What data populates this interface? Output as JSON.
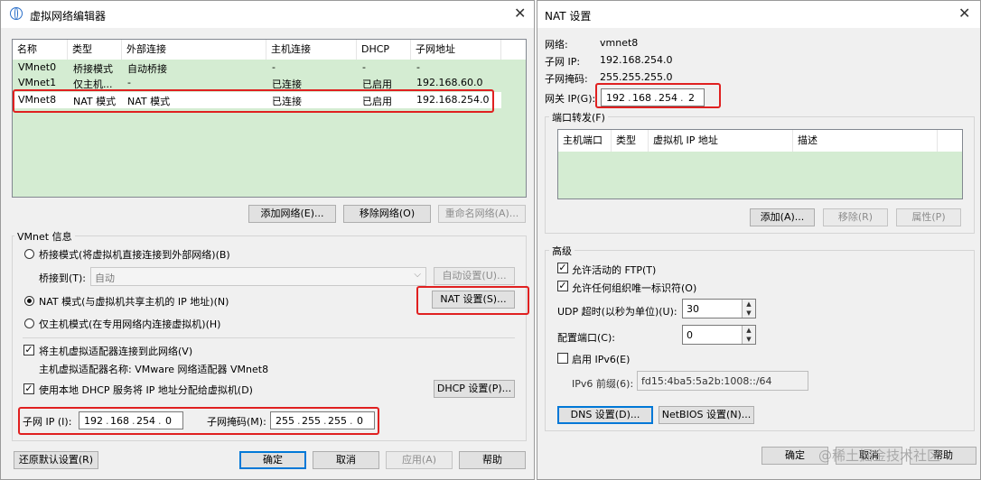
{
  "vne": {
    "title": "虚拟网络编辑器",
    "columns": [
      "名称",
      "类型",
      "外部连接",
      "主机连接",
      "DHCP",
      "子网地址"
    ],
    "rows": [
      [
        "VMnet0",
        "桥接模式",
        "自动桥接",
        "-",
        "-",
        "-"
      ],
      [
        "VMnet1",
        "仅主机...",
        "-",
        "已连接",
        "已启用",
        "192.168.60.0"
      ],
      [
        "VMnet8",
        "NAT 模式",
        "NAT 模式",
        "已连接",
        "已启用",
        "192.168.254.0"
      ]
    ],
    "add_network": "添加网络(E)...",
    "remove_network": "移除网络(O)",
    "rename_network": "重命名网络(A)...",
    "vmnet_info": "VMnet 信息",
    "bridge_mode": "桥接模式(将虚拟机直接连接到外部网络)(B)",
    "bridge_to_label": "桥接到(T):",
    "bridge_to_value": "自动",
    "auto_settings": "自动设置(U)...",
    "nat_mode": "NAT 模式(与虚拟机共享主机的 IP 地址)(N)",
    "nat_settings": "NAT 设置(S)...",
    "host_only": "仅主机模式(在专用网络内连接虚拟机)(H)",
    "connect_adapter": "将主机虚拟适配器连接到此网络(V)",
    "adapter_name": "主机虚拟适配器名称: VMware 网络适配器 VMnet8",
    "use_dhcp": "使用本地 DHCP 服务将 IP 地址分配给虚拟机(D)",
    "dhcp_settings": "DHCP 设置(P)...",
    "subnet_ip_label": "子网 IP (I):",
    "subnet_ip": [
      "192",
      "168",
      "254",
      "0"
    ],
    "subnet_mask_label": "子网掩码(M):",
    "subnet_mask": [
      "255",
      "255",
      "255",
      "0"
    ],
    "restore_defaults": "还原默认设置(R)",
    "ok": "确定",
    "cancel": "取消",
    "apply": "应用(A)",
    "help": "帮助"
  },
  "nat": {
    "title": "NAT 设置",
    "network_label": "网络:",
    "network_value": "vmnet8",
    "subnet_ip_label": "子网 IP:",
    "subnet_ip_value": "192.168.254.0",
    "subnet_mask_label": "子网掩码:",
    "subnet_mask_value": "255.255.255.0",
    "gateway_label": "网关 IP(G):",
    "gateway": [
      "192",
      "168",
      "254",
      "2"
    ],
    "port_forwarding": "端口转发(F)",
    "pf_columns": [
      "主机端口",
      "类型",
      "虚拟机 IP 地址",
      "描述"
    ],
    "add": "添加(A)...",
    "remove": "移除(R)",
    "properties": "属性(P)",
    "advanced": "高级",
    "allow_ftp": "允许活动的 FTP(T)",
    "allow_oui": "允许任何组织唯一标识符(O)",
    "udp_label": "UDP 超时(以秒为单位)(U):",
    "udp_value": "30",
    "config_port_label": "配置端口(C):",
    "config_port_value": "0",
    "enable_ipv6": "启用 IPv6(E)",
    "ipv6_prefix_label": "IPv6 前缀(6):",
    "ipv6_prefix_value": "fd15:4ba5:5a2b:1008::/64",
    "dns_settings": "DNS 设置(D)...",
    "netbios_settings": "NetBIOS 设置(N)...",
    "ok": "确定",
    "cancel": "取消",
    "help": "帮助"
  },
  "watermark": "@稀土掘金技术社区",
  "colors": {
    "list_green": "#d4ecd2",
    "selection_red": "#e02020",
    "focus_blue": "#0078d7"
  }
}
